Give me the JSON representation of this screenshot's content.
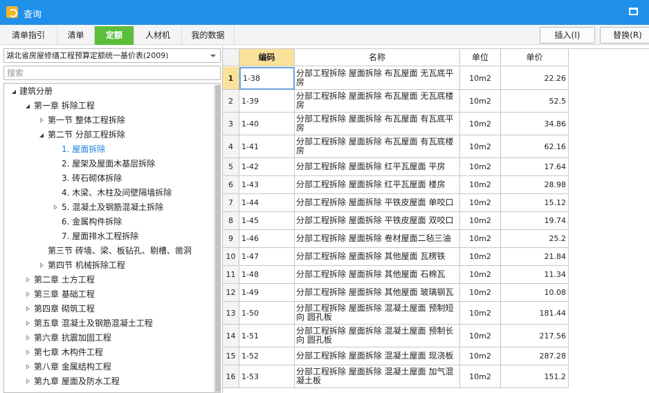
{
  "window": {
    "title": "查询"
  },
  "tabs": [
    {
      "label": "清单指引"
    },
    {
      "label": "清单"
    },
    {
      "label": "定额",
      "active": true
    },
    {
      "label": "人材机"
    },
    {
      "label": "我的数据"
    }
  ],
  "actions": {
    "insert_label": "插入(I)",
    "replace_label": "替换(R)"
  },
  "library": {
    "selected": "湖北省房屋修缮工程预算定额统一基价表(2009)"
  },
  "search": {
    "placeholder": "搜索"
  },
  "tree": [
    {
      "label": "建筑分册",
      "state": "expanded"
    },
    {
      "label": "第一章  拆除工程",
      "state": "expanded"
    },
    {
      "label": "第一节  整体工程拆除",
      "state": "collapsed"
    },
    {
      "label": "第二节  分部工程拆除",
      "state": "expanded"
    },
    {
      "label": "1.  屋面拆除",
      "state": "leaf",
      "selected": true
    },
    {
      "label": "2.  屋架及屋面木基层拆除",
      "state": "leaf"
    },
    {
      "label": "3.  砖石砌体拆除",
      "state": "leaf"
    },
    {
      "label": "4.  木梁、木柱及间壁隔墙拆除",
      "state": "leaf"
    },
    {
      "label": "5.  混凝土及钢筋混凝土拆除",
      "state": "collapsed"
    },
    {
      "label": "6.  金属构件拆除",
      "state": "leaf"
    },
    {
      "label": "7.  屋面排水工程拆除",
      "state": "leaf"
    },
    {
      "label": "第三节  砖墙、梁、板钻孔、剔槽、凿洞",
      "state": "leaf"
    },
    {
      "label": "第四节  机械拆除工程",
      "state": "collapsed"
    },
    {
      "label": "第二章  土方工程",
      "state": "collapsed"
    },
    {
      "label": "第三章  基础工程",
      "state": "collapsed"
    },
    {
      "label": "第四章  砌筑工程",
      "state": "collapsed"
    },
    {
      "label": "第五章  混凝土及钢筋混凝土工程",
      "state": "collapsed"
    },
    {
      "label": "第六章  抗震加固工程",
      "state": "collapsed"
    },
    {
      "label": "第七章  木构件工程",
      "state": "collapsed"
    },
    {
      "label": "第八章  金属结构工程",
      "state": "collapsed"
    },
    {
      "label": "第九章  屋面及防水工程",
      "state": "collapsed"
    }
  ],
  "table": {
    "headers": {
      "code": "编码",
      "name": "名称",
      "unit": "单位",
      "price": "单价"
    },
    "rows": [
      {
        "idx": "1",
        "code": "1-38",
        "name": "分部工程拆除 屋面拆除 布瓦屋面 无瓦底平房",
        "unit": "10m2",
        "price": "22.26"
      },
      {
        "idx": "2",
        "code": "1-39",
        "name": "分部工程拆除 屋面拆除 布瓦屋面 无瓦底楼房",
        "unit": "10m2",
        "price": "52.5"
      },
      {
        "idx": "3",
        "code": "1-40",
        "name": "分部工程拆除 屋面拆除 布瓦屋面 有瓦底平房",
        "unit": "10m2",
        "price": "34.86"
      },
      {
        "idx": "4",
        "code": "1-41",
        "name": "分部工程拆除 屋面拆除 布瓦屋面 有瓦底楼房",
        "unit": "10m2",
        "price": "62.16"
      },
      {
        "idx": "5",
        "code": "1-42",
        "name": "分部工程拆除 屋面拆除 红平瓦屋面 平房",
        "unit": "10m2",
        "price": "17.64"
      },
      {
        "idx": "6",
        "code": "1-43",
        "name": "分部工程拆除 屋面拆除 红平瓦屋面 楼房",
        "unit": "10m2",
        "price": "28.98"
      },
      {
        "idx": "7",
        "code": "1-44",
        "name": "分部工程拆除 屋面拆除 平铁皮屋面 单咬口",
        "unit": "10m2",
        "price": "15.12"
      },
      {
        "idx": "8",
        "code": "1-45",
        "name": "分部工程拆除 屋面拆除 平铁皮屋面 双咬口",
        "unit": "10m2",
        "price": "19.74"
      },
      {
        "idx": "9",
        "code": "1-46",
        "name": "分部工程拆除 屋面拆除 卷材屋面二毡三油",
        "unit": "10m2",
        "price": "25.2"
      },
      {
        "idx": "10",
        "code": "1-47",
        "name": "分部工程拆除 屋面拆除 其他屋面 瓦楞铁",
        "unit": "10m2",
        "price": "21.84"
      },
      {
        "idx": "11",
        "code": "1-48",
        "name": "分部工程拆除 屋面拆除 其他屋面 石棉瓦",
        "unit": "10m2",
        "price": "11.34"
      },
      {
        "idx": "12",
        "code": "1-49",
        "name": "分部工程拆除 屋面拆除 其他屋面 玻璃钢瓦",
        "unit": "10m2",
        "price": "10.08"
      },
      {
        "idx": "13",
        "code": "1-50",
        "name": "分部工程拆除 屋面拆除 混凝土屋面 预制短向 圆孔板",
        "unit": "10m2",
        "price": "181.44"
      },
      {
        "idx": "14",
        "code": "1-51",
        "name": "分部工程拆除 屋面拆除 混凝土屋面 预制长向 圆孔板",
        "unit": "10m2",
        "price": "217.56"
      },
      {
        "idx": "15",
        "code": "1-52",
        "name": "分部工程拆除 屋面拆除 混凝土屋面 现浇板",
        "unit": "10m2",
        "price": "287.28"
      },
      {
        "idx": "16",
        "code": "1-53",
        "name": "分部工程拆除 屋面拆除 混凝土屋面 加气混凝土板",
        "unit": "10m2",
        "price": "151.2"
      }
    ]
  }
}
